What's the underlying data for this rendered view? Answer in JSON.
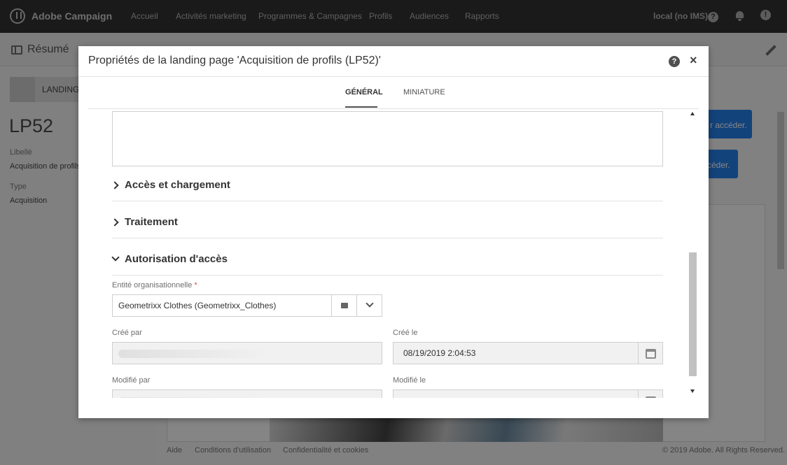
{
  "topbar": {
    "brand": "Adobe Campaign",
    "nav": [
      "Accueil",
      "Activités marketing",
      "Programmes & Campagnes",
      "Profils",
      "Audiences",
      "Rapports"
    ],
    "user": "local (no IMS)",
    "help_glyph": "?",
    "profile_glyph": "!"
  },
  "page": {
    "breadcrumb": "Résumé",
    "card_label": "LANDING",
    "title": "LP52",
    "label_heading": "Libellé",
    "label_value": "Acquisition de profils",
    "type_heading": "Type",
    "type_value": "Acquisition",
    "btn1": "r accéder.",
    "btn2": "céder.",
    "footer": {
      "help": "Aide",
      "terms": "Conditions d'utilisation",
      "privacy": "Confidentialité et cookies",
      "copyright": "© 2019 Adobe. All Rights Reserved."
    }
  },
  "modal": {
    "title": "Propriétés de la landing page 'Acquisition de profils (LP52)'",
    "help_glyph": "?",
    "close_glyph": "×",
    "tabs": [
      "GÉNÉRAL",
      "MINIATURE"
    ],
    "active_tab": "GÉNÉRAL",
    "sections": {
      "access_loading": "Accès et chargement",
      "processing": "Traitement",
      "access_authorization": "Autorisation d'accès"
    },
    "fields": {
      "org_unit_label": "Entité organisationnelle",
      "org_unit_required": "*",
      "org_unit_value": "Geometrixx Clothes (Geometrixx_Clothes)",
      "created_by_label": "Créé par",
      "created_on_label": "Créé le",
      "created_on_value": "08/19/2019 2:04:53",
      "modified_by_label": "Modifié par",
      "modified_on_label": "Modifié le"
    }
  }
}
